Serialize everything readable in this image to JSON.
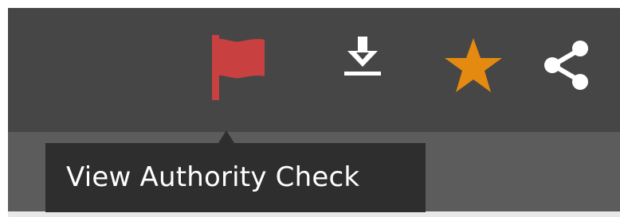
{
  "colors": {
    "toolbar_bg": "#464646",
    "subbar_bg": "#5c5c5c",
    "tooltip_bg": "#2e2e2e",
    "flag": "#c94040",
    "star": "#e48a10",
    "icon_white": "#ffffff"
  },
  "toolbar": {
    "buttons": [
      {
        "icon": "flag-icon"
      },
      {
        "icon": "download-icon"
      },
      {
        "icon": "star-icon"
      },
      {
        "icon": "share-icon"
      }
    ]
  },
  "tooltip": {
    "text": "View Authority Check"
  }
}
